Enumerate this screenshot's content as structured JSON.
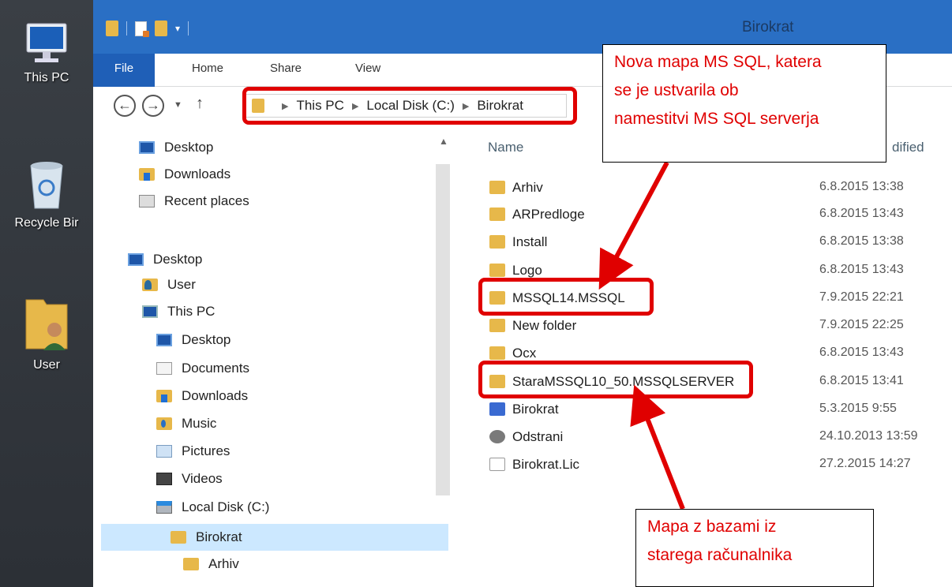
{
  "desktop": {
    "icons": [
      {
        "label": "This PC",
        "icon": "monitor-icon"
      },
      {
        "label": "Recycle Bir",
        "icon": "recycle-bin-icon"
      },
      {
        "label": "User",
        "icon": "user-folder-icon"
      }
    ]
  },
  "window": {
    "title": "Birokrat",
    "ribbon_tabs": [
      "File",
      "Home",
      "Share",
      "View"
    ],
    "address": {
      "segments": [
        "This PC",
        "Local Disk (C:)",
        "Birokrat"
      ]
    },
    "nav_buttons": {
      "back": "back-icon",
      "forward": "forward-icon",
      "recent": "dropdown-icon",
      "up": "up-icon"
    }
  },
  "nav_pane": {
    "items": [
      {
        "label": "Desktop",
        "icon": "desktop-icon",
        "level": 0
      },
      {
        "label": "Downloads",
        "icon": "downloads-icon",
        "level": 0
      },
      {
        "label": "Recent places",
        "icon": "recent-places-icon",
        "level": 0
      },
      {
        "label": "Desktop",
        "icon": "desktop-icon",
        "level": 0
      },
      {
        "label": "User",
        "icon": "user-icon",
        "level": 1
      },
      {
        "label": "This PC",
        "icon": "this-pc-icon",
        "level": 1
      },
      {
        "label": "Desktop",
        "icon": "desktop-icon",
        "level": 2
      },
      {
        "label": "Documents",
        "icon": "documents-icon",
        "level": 2
      },
      {
        "label": "Downloads",
        "icon": "downloads-icon",
        "level": 2
      },
      {
        "label": "Music",
        "icon": "music-icon",
        "level": 2
      },
      {
        "label": "Pictures",
        "icon": "pictures-icon",
        "level": 2
      },
      {
        "label": "Videos",
        "icon": "videos-icon",
        "level": 2
      },
      {
        "label": "Local Disk (C:)",
        "icon": "local-disk-icon",
        "level": 2
      },
      {
        "label": "Birokrat",
        "icon": "folder-icon",
        "level": 3,
        "selected": true
      },
      {
        "label": "Arhiv",
        "icon": "folder-icon",
        "level": 4
      }
    ]
  },
  "file_list": {
    "columns": {
      "name": "Name",
      "date": "dified"
    },
    "rows": [
      {
        "name": "Arhiv",
        "date": "6.8.2015 13:38",
        "type": "folder"
      },
      {
        "name": "ARPredloge",
        "date": "6.8.2015 13:43",
        "type": "folder"
      },
      {
        "name": "Install",
        "date": "6.8.2015 13:38",
        "type": "folder"
      },
      {
        "name": "Logo",
        "date": "6.8.2015 13:43",
        "type": "folder"
      },
      {
        "name": "MSSQL14.MSSQL",
        "date": "7.9.2015 22:21",
        "type": "folder"
      },
      {
        "name": "New folder",
        "date": "7.9.2015 22:25",
        "type": "folder"
      },
      {
        "name": "Ocx",
        "date": "6.8.2015 13:43",
        "type": "folder"
      },
      {
        "name": "StaraMSSQL10_50.MSSQLSERVER",
        "date": "6.8.2015 13:41",
        "type": "folder"
      },
      {
        "name": "Birokrat",
        "date": "5.3.2015 9:55",
        "type": "application"
      },
      {
        "name": "Odstrani",
        "date": "24.10.2013 13:59",
        "type": "setup"
      },
      {
        "name": "Birokrat.Lic",
        "date": "27.2.2015 14:27",
        "type": "document"
      }
    ]
  },
  "annotations": {
    "top_callout": [
      "Nova mapa MS SQL, katera",
      "se je ustvarila ob",
      "namestitvi MS SQL serverja"
    ],
    "bottom_callout": [
      "Mapa z bazami iz",
      "starega računalnika"
    ],
    "highlight_color": "#e00000"
  },
  "colors": {
    "titlebar": "#2a6fc4",
    "file_tab": "#1f5fb7",
    "selection": "#cce8ff",
    "folder": "#e7b84a"
  }
}
